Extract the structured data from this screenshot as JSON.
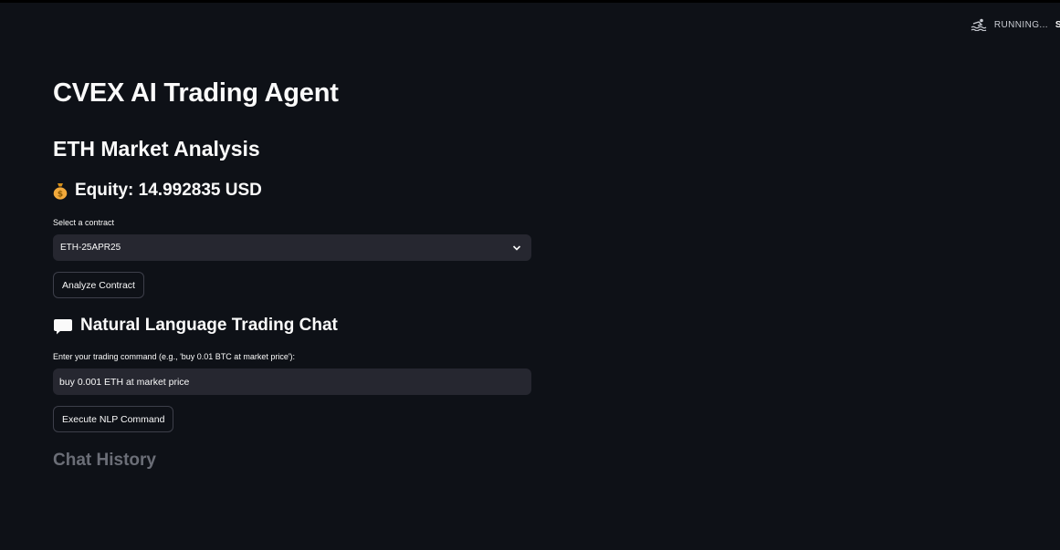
{
  "status": {
    "running_label": "RUNNING...",
    "trailing_letter": "S",
    "icon": "swimmer-icon"
  },
  "page": {
    "title": "CVEX AI Trading Agent",
    "subtitle": "ETH Market Analysis",
    "equity_text": "Equity: 14.992835 USD",
    "equity_icon": "money-bag-icon"
  },
  "contract_select": {
    "label": "Select a contract",
    "selected": "ETH-25APR25"
  },
  "analyze_button": "Analyze Contract",
  "chat_section": {
    "heading": "Natural Language Trading Chat",
    "heading_icon": "speech-bubble-icon",
    "input_label": "Enter your trading command (e.g., 'buy 0.01 BTC at market price'):",
    "input_value": "buy 0.001 ETH at market price",
    "execute_button": "Execute NLP Command",
    "history_heading": "Chat History"
  },
  "colors": {
    "background": "#0e1117",
    "input_bg": "#262730",
    "muted_heading": "#6b6e77"
  }
}
